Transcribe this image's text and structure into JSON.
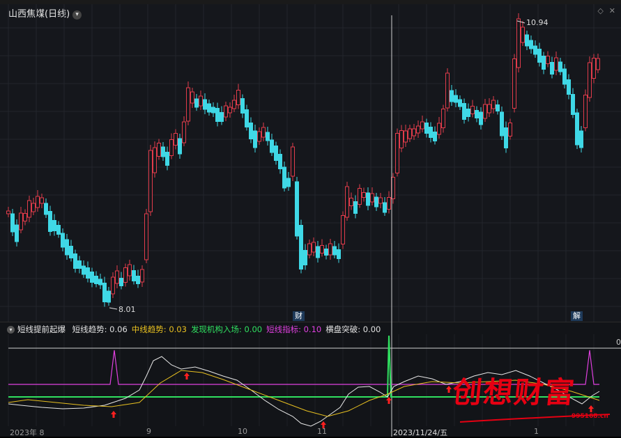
{
  "window": {
    "title": "山西焦煤(日线)"
  },
  "main_chart": {
    "high_label": "10.94",
    "low_label": "8.01",
    "marker_cai": "财",
    "marker_jie": "解"
  },
  "indicator": {
    "name": "短线提前起爆",
    "items": [
      {
        "label": "短线趋势:",
        "value": "0.06",
        "color": "#e0e0e0"
      },
      {
        "label": "中线趋势:",
        "value": "0.03",
        "color": "#e8c020"
      },
      {
        "label": "发现机构入场:",
        "value": "0.00",
        "color": "#30e060"
      },
      {
        "label": "短线指标:",
        "value": "0.10",
        "color": "#e040e0"
      },
      {
        "label": "横盘突破:",
        "value": "0.00",
        "color": "#e0e0e0"
      }
    ],
    "zero_label": "0"
  },
  "x_axis": {
    "labels": [
      "2023年 8",
      "9",
      "10",
      "11",
      "2023/11/24/五",
      "1"
    ]
  },
  "watermark": {
    "text": "创想财富",
    "url": "995168.cn"
  },
  "colors": {
    "up": "#e23c4b",
    "down": "#3fd8e6",
    "background": "#15171c"
  }
}
